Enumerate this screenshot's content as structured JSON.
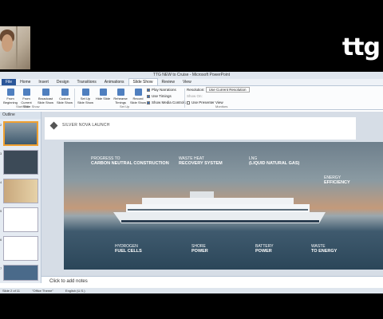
{
  "window": {
    "title": "TTG NEW to Cruise - Microsoft PowerPoint"
  },
  "brand": {
    "logo": "ttg"
  },
  "ribbon": {
    "tabs": [
      "File",
      "Home",
      "Insert",
      "Design",
      "Transitions",
      "Animations",
      "Slide Show",
      "Review",
      "View"
    ],
    "buttons": {
      "from_beginning": "From Beginning",
      "from_current": "From Current Slide",
      "broadcast": "Broadcast Slide Show",
      "custom": "Custom Slide Show",
      "setup": "Set Up Slide Show",
      "hide": "Hide Slide",
      "rehearse": "Rehearse Timings",
      "record": "Record Slide Show"
    },
    "checks": {
      "play_narrations": "Play Narrations",
      "use_timings": "Use Timings",
      "show_media": "Show Media Controls",
      "resolution": "Resolution:",
      "resolution_value": "Use Current Resolution",
      "show_on": "Show On:",
      "presenter_view": "Use Presenter View"
    },
    "groups": {
      "start": "Start Slide Show",
      "setup": "Set Up",
      "monitors": "Monitors"
    }
  },
  "outline": {
    "header": "Outline",
    "slides": [
      "2",
      "3",
      "4",
      "5",
      "6",
      "7",
      "8"
    ]
  },
  "slide": {
    "header_title": "SILVER NOVA LAUNCH",
    "labels": {
      "carbon": [
        "Progress to",
        "Carbon Neutral Construction"
      ],
      "waste_heat": [
        "Waste Heat",
        "Recovery System"
      ],
      "lng": [
        "LNG",
        "(Liquid Natural Gas)"
      ],
      "energy_eff": [
        "Energy",
        "Efficiency"
      ],
      "hydrogen": [
        "Hydrogen",
        "Fuel Cells"
      ],
      "shore": [
        "Shore",
        "Power"
      ],
      "battery": [
        "Battery",
        "Power"
      ],
      "waste_energy": [
        "Waste",
        "to Energy"
      ]
    }
  },
  "notes": {
    "placeholder": "Click to add notes"
  },
  "status": {
    "slide": "Slide 2 of 11",
    "theme": "\"Office Theme\"",
    "lang": "English (U.S.)"
  }
}
